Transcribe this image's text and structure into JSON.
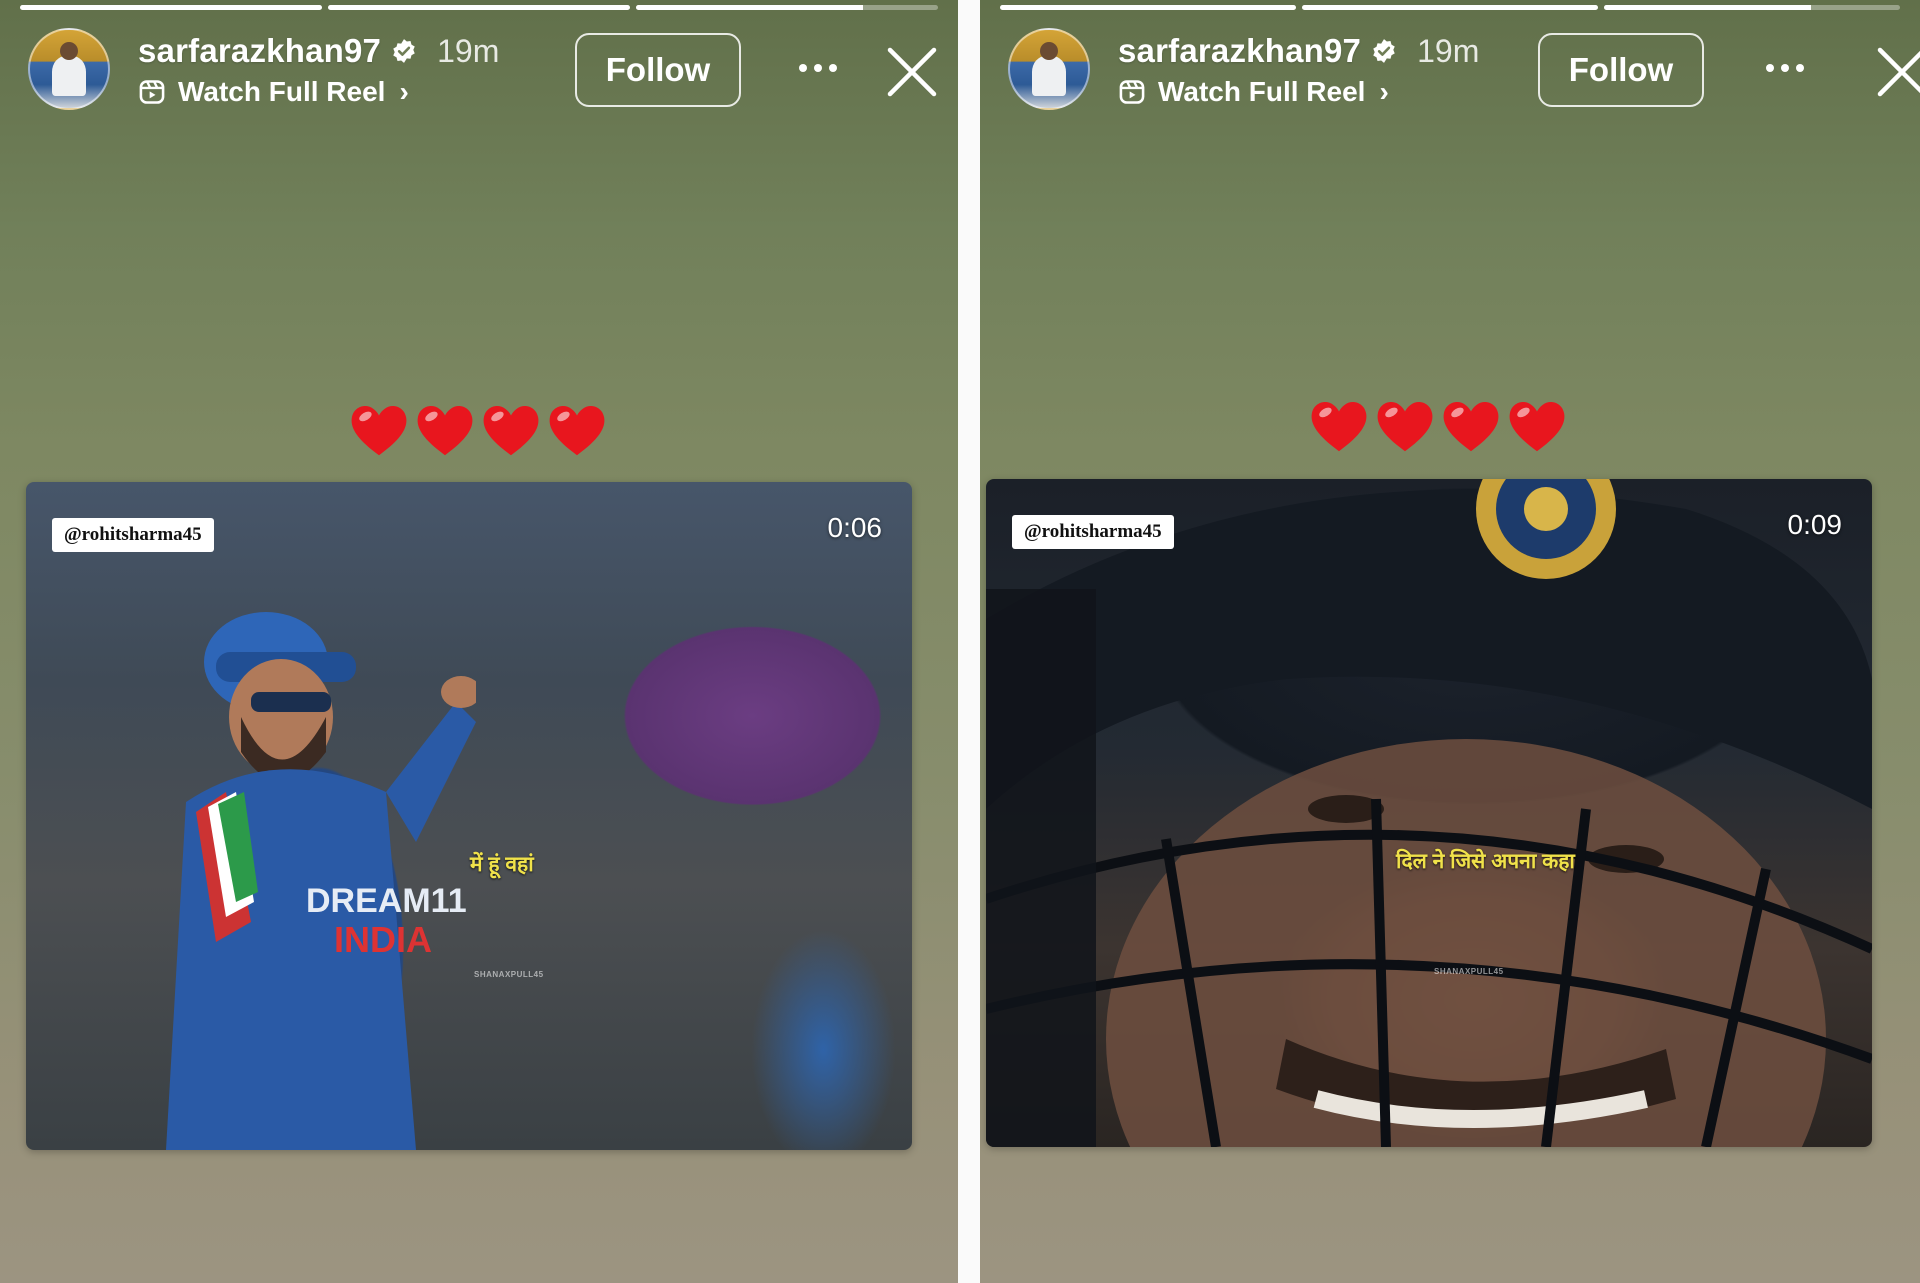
{
  "stories": [
    {
      "username": "sarfarazkhan97",
      "time": "19m",
      "reel_label": "Watch Full Reel",
      "follow_label": "Follow",
      "progress": [
        1,
        1,
        0.75
      ],
      "video": {
        "handle": "@rohitsharma45",
        "duration": "0:06",
        "caption": "में हूं वहां",
        "watermark": "SHANAXPULL45",
        "jersey_text": "DREAM11",
        "jersey_sub": "INDIA"
      }
    },
    {
      "username": "sarfarazkhan97",
      "time": "19m",
      "reel_label": "Watch Full Reel",
      "follow_label": "Follow",
      "progress": [
        1,
        1,
        0.7
      ],
      "video": {
        "handle": "@rohitsharma45",
        "duration": "0:09",
        "caption": "दिल ने जिसे अपना कहा",
        "watermark": "SHANAXPULL45"
      }
    }
  ],
  "hearts_count": 4,
  "colors": {
    "heart": "#e8161e",
    "caption": "#f0e24a",
    "verified": "#ffffff"
  },
  "icons": {
    "verified": "verified-badge-icon",
    "reel": "reel-icon",
    "chevron": "chevron-right-icon",
    "more": "more-horizontal-icon",
    "close": "close-icon",
    "heart": "heart-icon"
  }
}
